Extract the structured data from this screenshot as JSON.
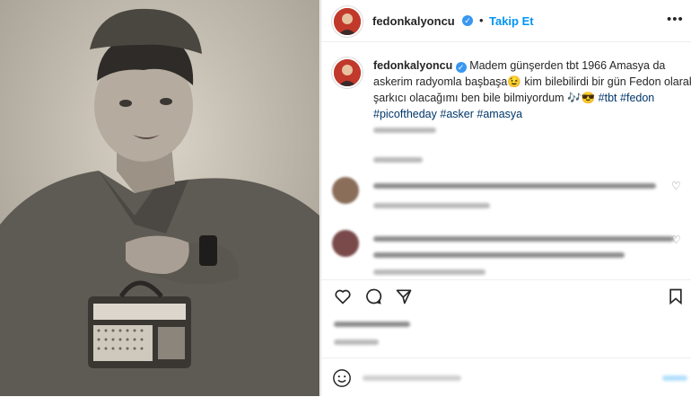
{
  "post": {
    "username": "fedonkalyoncu",
    "follow_label": "Takip Et",
    "separator": "•",
    "more_glyph": "•••",
    "caption_text": "Madem günşerden tbt 1966 Amasya da askerim radyomla başbaşa😉  kim bilebilirdi bir gün Fedon olarak şarkıcı olacağımı ben bile bilmiyordum 🎶😎",
    "hashtags": [
      "#tbt",
      "#fedon",
      "#picoftheday",
      "#asker",
      "#amasya"
    ],
    "colors": {
      "link": "#0095f6",
      "hashtag": "#00376b",
      "verified": "#3897f0"
    }
  },
  "icons": {
    "heart": "heart-icon",
    "comment": "comment-icon",
    "share": "share-icon",
    "save": "bookmark-icon",
    "emoji": "emoji-icon",
    "verified": "verified-badge-icon"
  }
}
